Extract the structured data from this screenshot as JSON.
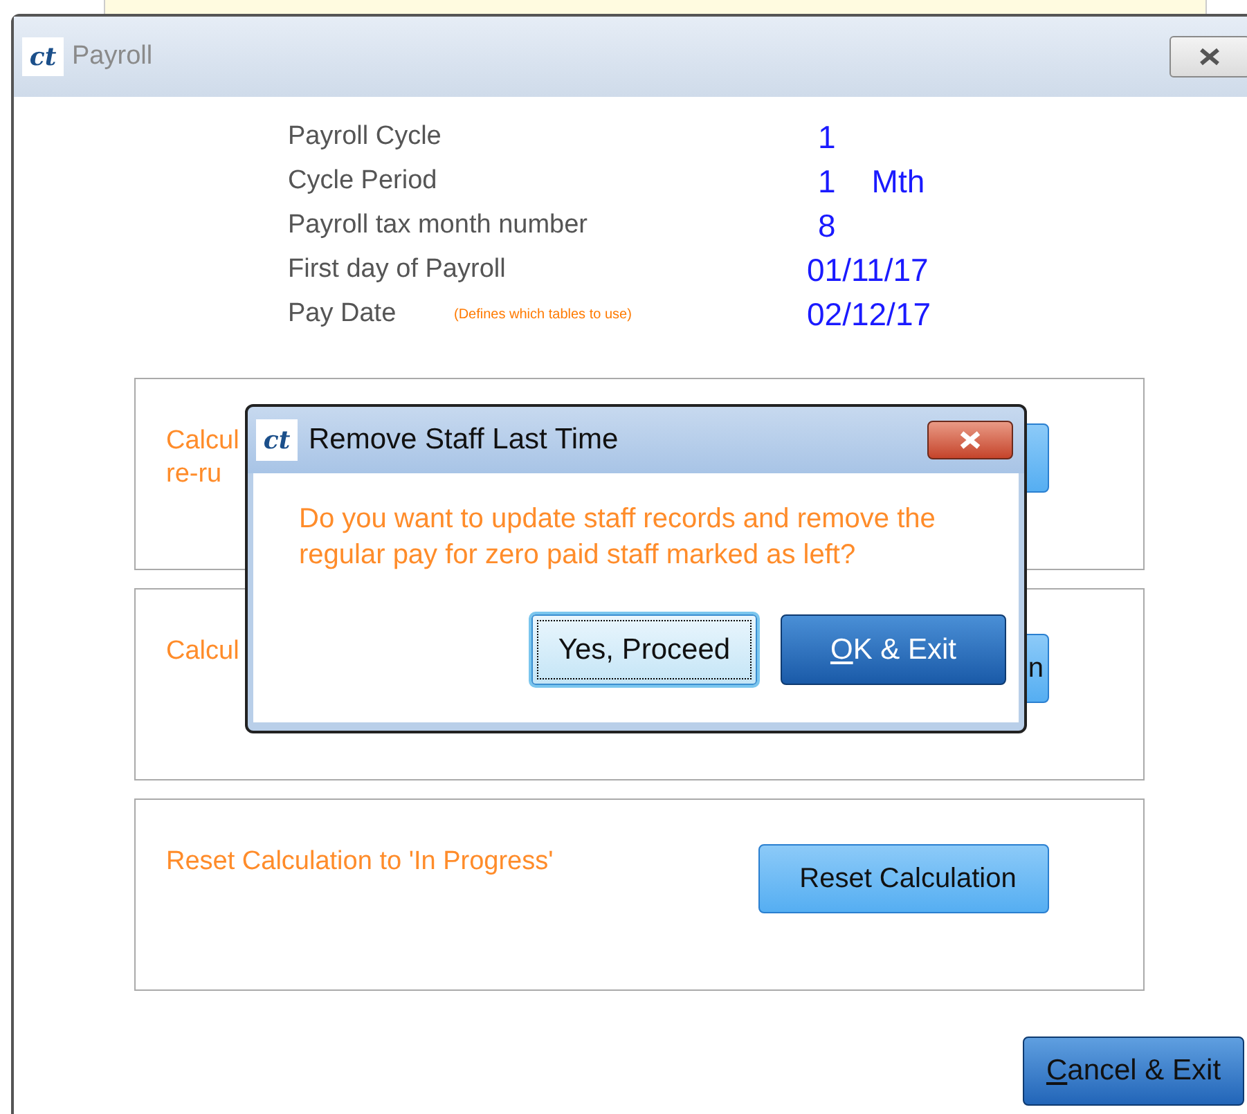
{
  "window": {
    "logo": "ct",
    "title": "Payroll"
  },
  "info": [
    {
      "label": "Payroll Cycle",
      "value": "1"
    },
    {
      "label": "Cycle Period",
      "value": "1",
      "unit": "Mth"
    },
    {
      "label": "Payroll tax month number",
      "value": "8"
    },
    {
      "label": "First day of Payroll",
      "value": "01/11/17"
    },
    {
      "label": "Pay Date",
      "note": "(Defines which tables to use)",
      "value": "02/12/17"
    }
  ],
  "panels": [
    {
      "lines": [
        "Calcul",
        "re-ru"
      ]
    },
    {
      "lines": [
        "Calcul"
      ],
      "button": {
        "label": "n"
      }
    },
    {
      "lines": [
        "Reset Calculation to 'In Progress'"
      ],
      "button": {
        "label": "Reset Calculation"
      }
    }
  ],
  "cancel_button": {
    "accel": "C",
    "label": "ancel & Exit"
  },
  "dialog": {
    "logo": "ct",
    "title": "Remove Staff Last Time",
    "message": "Do you want to update staff records and remove the regular pay for zero paid staff marked as left?",
    "buttons": [
      {
        "kind": "plain",
        "label": "Yes, Proceed",
        "selected": true
      },
      {
        "kind": "primary",
        "accel": "O",
        "label": "K & Exit",
        "selected": false
      }
    ]
  }
}
